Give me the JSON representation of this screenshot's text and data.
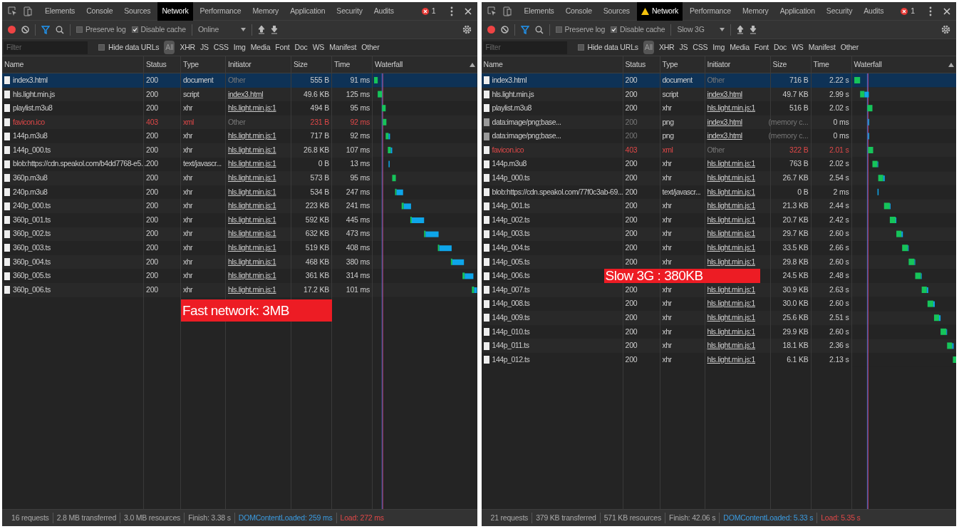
{
  "panels": [
    {
      "tabs": [
        {
          "label": "Elements",
          "selected": false,
          "warning": false
        },
        {
          "label": "Console",
          "selected": false,
          "warning": false
        },
        {
          "label": "Sources",
          "selected": false,
          "warning": false
        },
        {
          "label": "Network",
          "selected": true,
          "warning": false
        },
        {
          "label": "Performance",
          "selected": false,
          "warning": false
        },
        {
          "label": "Memory",
          "selected": false,
          "warning": false
        },
        {
          "label": "Application",
          "selected": false,
          "warning": false
        },
        {
          "label": "Security",
          "selected": false,
          "warning": false
        },
        {
          "label": "Audits",
          "selected": false,
          "warning": false
        }
      ],
      "error_count": "1",
      "preserve_log": {
        "label": "Preserve log",
        "checked": false
      },
      "disable_cache": {
        "label": "Disable cache",
        "checked": true
      },
      "throttle": "Online",
      "filter": {
        "placeholder": "Filter"
      },
      "hide_data_urls": {
        "label": "Hide data URLs",
        "checked": false
      },
      "type_filters": [
        {
          "label": "All",
          "selected": true
        },
        {
          "label": "XHR",
          "selected": false
        },
        {
          "label": "JS",
          "selected": false
        },
        {
          "label": "CSS",
          "selected": false
        },
        {
          "label": "Img",
          "selected": false
        },
        {
          "label": "Media",
          "selected": false
        },
        {
          "label": "Font",
          "selected": false
        },
        {
          "label": "Doc",
          "selected": false
        },
        {
          "label": "WS",
          "selected": false
        },
        {
          "label": "Manifest",
          "selected": false
        },
        {
          "label": "Other",
          "selected": false
        }
      ],
      "columns": [
        "Name",
        "Status",
        "Type",
        "Initiator",
        "Size",
        "Time",
        "Waterfall"
      ],
      "rows": [
        {
          "name": "index3.html",
          "status": "200",
          "type": "document",
          "initiator": "Other",
          "initiator_link": false,
          "size": "555 B",
          "time": "91 ms",
          "selected": true,
          "error": false,
          "from_cache": false
        },
        {
          "name": "hls.light.min.js",
          "status": "200",
          "type": "script",
          "initiator": "index3.html",
          "initiator_link": true,
          "size": "49.6 KB",
          "time": "125 ms",
          "selected": false,
          "error": false,
          "from_cache": false
        },
        {
          "name": "playlist.m3u8",
          "status": "200",
          "type": "xhr",
          "initiator": "hls.light.min.js:1",
          "initiator_link": true,
          "size": "494 B",
          "time": "95 ms",
          "selected": false,
          "error": false,
          "from_cache": false
        },
        {
          "name": "favicon.ico",
          "status": "403",
          "type": "xml",
          "initiator": "Other",
          "initiator_link": false,
          "size": "231 B",
          "time": "92 ms",
          "selected": false,
          "error": true,
          "from_cache": false
        },
        {
          "name": "144p.m3u8",
          "status": "200",
          "type": "xhr",
          "initiator": "hls.light.min.js:1",
          "initiator_link": true,
          "size": "717 B",
          "time": "92 ms",
          "selected": false,
          "error": false,
          "from_cache": false
        },
        {
          "name": "144p_000.ts",
          "status": "200",
          "type": "xhr",
          "initiator": "hls.light.min.js:1",
          "initiator_link": true,
          "size": "26.8 KB",
          "time": "107 ms",
          "selected": false,
          "error": false,
          "from_cache": false
        },
        {
          "name": "blob:https://cdn.speakol.com/b4dd7768-e5...",
          "status": "200",
          "type": "text/javascr...",
          "initiator": "hls.light.min.js:1",
          "initiator_link": true,
          "size": "0 B",
          "time": "13 ms",
          "selected": false,
          "error": false,
          "from_cache": false
        },
        {
          "name": "360p.m3u8",
          "status": "200",
          "type": "xhr",
          "initiator": "hls.light.min.js:1",
          "initiator_link": true,
          "size": "573 B",
          "time": "95 ms",
          "selected": false,
          "error": false,
          "from_cache": false
        },
        {
          "name": "240p.m3u8",
          "status": "200",
          "type": "xhr",
          "initiator": "hls.light.min.js:1",
          "initiator_link": true,
          "size": "534 B",
          "time": "247 ms",
          "selected": false,
          "error": false,
          "from_cache": false
        },
        {
          "name": "240p_000.ts",
          "status": "200",
          "type": "xhr",
          "initiator": "hls.light.min.js:1",
          "initiator_link": true,
          "size": "223 KB",
          "time": "241 ms",
          "selected": false,
          "error": false,
          "from_cache": false
        },
        {
          "name": "360p_001.ts",
          "status": "200",
          "type": "xhr",
          "initiator": "hls.light.min.js:1",
          "initiator_link": true,
          "size": "592 KB",
          "time": "445 ms",
          "selected": false,
          "error": false,
          "from_cache": false
        },
        {
          "name": "360p_002.ts",
          "status": "200",
          "type": "xhr",
          "initiator": "hls.light.min.js:1",
          "initiator_link": true,
          "size": "632 KB",
          "time": "473 ms",
          "selected": false,
          "error": false,
          "from_cache": false
        },
        {
          "name": "360p_003.ts",
          "status": "200",
          "type": "xhr",
          "initiator": "hls.light.min.js:1",
          "initiator_link": true,
          "size": "519 KB",
          "time": "408 ms",
          "selected": false,
          "error": false,
          "from_cache": false
        },
        {
          "name": "360p_004.ts",
          "status": "200",
          "type": "xhr",
          "initiator": "hls.light.min.js:1",
          "initiator_link": true,
          "size": "468 KB",
          "time": "380 ms",
          "selected": false,
          "error": false,
          "from_cache": false
        },
        {
          "name": "360p_005.ts",
          "status": "200",
          "type": "xhr",
          "initiator": "hls.light.min.js:1",
          "initiator_link": true,
          "size": "361 KB",
          "time": "314 ms",
          "selected": false,
          "error": false,
          "from_cache": false
        },
        {
          "name": "360p_006.ts",
          "status": "200",
          "type": "xhr",
          "initiator": "hls.light.min.js:1",
          "initiator_link": true,
          "size": "17.2 KB",
          "time": "101 ms",
          "selected": false,
          "error": false,
          "from_cache": false
        }
      ],
      "summary": [
        {
          "text": "16 requests",
          "kind": "plain"
        },
        {
          "text": "2.8 MB transferred",
          "kind": "plain"
        },
        {
          "text": "3.0 MB resources",
          "kind": "plain"
        },
        {
          "text": "Finish: 3.38 s",
          "kind": "plain"
        },
        {
          "text": "DOMContentLoaded: 259 ms",
          "kind": "dom"
        },
        {
          "text": "Load: 272 ms",
          "kind": "load"
        }
      ],
      "annotation": "Fast network: 3MB"
    },
    {
      "tabs": [
        {
          "label": "Elements",
          "selected": false,
          "warning": false
        },
        {
          "label": "Console",
          "selected": false,
          "warning": false
        },
        {
          "label": "Sources",
          "selected": false,
          "warning": false
        },
        {
          "label": "Network",
          "selected": true,
          "warning": true
        },
        {
          "label": "Performance",
          "selected": false,
          "warning": false
        },
        {
          "label": "Memory",
          "selected": false,
          "warning": false
        },
        {
          "label": "Application",
          "selected": false,
          "warning": false
        },
        {
          "label": "Security",
          "selected": false,
          "warning": false
        },
        {
          "label": "Audits",
          "selected": false,
          "warning": false
        }
      ],
      "error_count": "1",
      "preserve_log": {
        "label": "Preserve log",
        "checked": false
      },
      "disable_cache": {
        "label": "Disable cache",
        "checked": true
      },
      "throttle": "Slow 3G",
      "filter": {
        "placeholder": "Filter"
      },
      "hide_data_urls": {
        "label": "Hide data URLs",
        "checked": false
      },
      "type_filters": [
        {
          "label": "All",
          "selected": true
        },
        {
          "label": "XHR",
          "selected": false
        },
        {
          "label": "JS",
          "selected": false
        },
        {
          "label": "CSS",
          "selected": false
        },
        {
          "label": "Img",
          "selected": false
        },
        {
          "label": "Media",
          "selected": false
        },
        {
          "label": "Font",
          "selected": false
        },
        {
          "label": "Doc",
          "selected": false
        },
        {
          "label": "WS",
          "selected": false
        },
        {
          "label": "Manifest",
          "selected": false
        },
        {
          "label": "Other",
          "selected": false
        }
      ],
      "columns": [
        "Name",
        "Status",
        "Type",
        "Initiator",
        "Size",
        "Time",
        "Waterfall"
      ],
      "rows": [
        {
          "name": "index3.html",
          "status": "200",
          "type": "document",
          "initiator": "Other",
          "initiator_link": false,
          "size": "716 B",
          "time": "2.22 s",
          "selected": true,
          "error": false,
          "from_cache": false
        },
        {
          "name": "hls.light.min.js",
          "status": "200",
          "type": "script",
          "initiator": "index3.html",
          "initiator_link": true,
          "size": "49.7 KB",
          "time": "2.99 s",
          "selected": false,
          "error": false,
          "from_cache": false
        },
        {
          "name": "playlist.m3u8",
          "status": "200",
          "type": "xhr",
          "initiator": "hls.light.min.js:1",
          "initiator_link": true,
          "size": "516 B",
          "time": "2.02 s",
          "selected": false,
          "error": false,
          "from_cache": false
        },
        {
          "name": "data:image/png;base...",
          "status": "200",
          "type": "png",
          "initiator": "index3.html",
          "initiator_link": true,
          "size": "(memory c...",
          "time": "0 ms",
          "selected": false,
          "error": false,
          "from_cache": true
        },
        {
          "name": "data:image/png;base...",
          "status": "200",
          "type": "png",
          "initiator": "index3.html",
          "initiator_link": true,
          "size": "(memory c...",
          "time": "0 ms",
          "selected": false,
          "error": false,
          "from_cache": true
        },
        {
          "name": "favicon.ico",
          "status": "403",
          "type": "xml",
          "initiator": "Other",
          "initiator_link": false,
          "size": "322 B",
          "time": "2.01 s",
          "selected": false,
          "error": true,
          "from_cache": false
        },
        {
          "name": "144p.m3u8",
          "status": "200",
          "type": "xhr",
          "initiator": "hls.light.min.js:1",
          "initiator_link": true,
          "size": "763 B",
          "time": "2.02 s",
          "selected": false,
          "error": false,
          "from_cache": false
        },
        {
          "name": "144p_000.ts",
          "status": "200",
          "type": "xhr",
          "initiator": "hls.light.min.js:1",
          "initiator_link": true,
          "size": "26.7 KB",
          "time": "2.54 s",
          "selected": false,
          "error": false,
          "from_cache": false
        },
        {
          "name": "blob:https://cdn.speakol.com/77f0c3ab-69...",
          "status": "200",
          "type": "text/javascr...",
          "initiator": "hls.light.min.js:1",
          "initiator_link": true,
          "size": "0 B",
          "time": "2 ms",
          "selected": false,
          "error": false,
          "from_cache": false
        },
        {
          "name": "144p_001.ts",
          "status": "200",
          "type": "xhr",
          "initiator": "hls.light.min.js:1",
          "initiator_link": true,
          "size": "21.3 KB",
          "time": "2.44 s",
          "selected": false,
          "error": false,
          "from_cache": false
        },
        {
          "name": "144p_002.ts",
          "status": "200",
          "type": "xhr",
          "initiator": "hls.light.min.js:1",
          "initiator_link": true,
          "size": "20.7 KB",
          "time": "2.42 s",
          "selected": false,
          "error": false,
          "from_cache": false
        },
        {
          "name": "144p_003.ts",
          "status": "200",
          "type": "xhr",
          "initiator": "hls.light.min.js:1",
          "initiator_link": true,
          "size": "29.7 KB",
          "time": "2.60 s",
          "selected": false,
          "error": false,
          "from_cache": false
        },
        {
          "name": "144p_004.ts",
          "status": "200",
          "type": "xhr",
          "initiator": "hls.light.min.js:1",
          "initiator_link": true,
          "size": "33.5 KB",
          "time": "2.66 s",
          "selected": false,
          "error": false,
          "from_cache": false
        },
        {
          "name": "144p_005.ts",
          "status": "200",
          "type": "xhr",
          "initiator": "hls.light.min.js:1",
          "initiator_link": true,
          "size": "29.8 KB",
          "time": "2.60 s",
          "selected": false,
          "error": false,
          "from_cache": false
        },
        {
          "name": "144p_006.ts",
          "size": "24.5 KB",
          "time": "2.48 s",
          "selected": false,
          "error": false,
          "from_cache": false
        },
        {
          "name": "144p_007.ts",
          "status": "200",
          "type": "xhr",
          "initiator": "hls.light.min.js:1",
          "initiator_link": true,
          "size": "30.9 KB",
          "time": "2.63 s",
          "selected": false,
          "error": false,
          "from_cache": false
        },
        {
          "name": "144p_008.ts",
          "status": "200",
          "type": "xhr",
          "initiator": "hls.light.min.js:1",
          "initiator_link": true,
          "size": "30.0 KB",
          "time": "2.60 s",
          "selected": false,
          "error": false,
          "from_cache": false
        },
        {
          "name": "144p_009.ts",
          "status": "200",
          "type": "xhr",
          "initiator": "hls.light.min.js:1",
          "initiator_link": true,
          "size": "25.6 KB",
          "time": "2.51 s",
          "selected": false,
          "error": false,
          "from_cache": false
        },
        {
          "name": "144p_010.ts",
          "status": "200",
          "type": "xhr",
          "initiator": "hls.light.min.js:1",
          "initiator_link": true,
          "size": "29.9 KB",
          "time": "2.60 s",
          "selected": false,
          "error": false,
          "from_cache": false
        },
        {
          "name": "144p_011.ts",
          "status": "200",
          "type": "xhr",
          "initiator": "hls.light.min.js:1",
          "initiator_link": true,
          "size": "18.1 KB",
          "time": "2.36 s",
          "selected": false,
          "error": false,
          "from_cache": false
        },
        {
          "name": "144p_012.ts",
          "status": "200",
          "type": "xhr",
          "initiator": "hls.light.min.js:1",
          "initiator_link": true,
          "size": "6.1 KB",
          "time": "2.13 s",
          "selected": false,
          "error": false,
          "from_cache": false
        }
      ],
      "summary": [
        {
          "text": "21 requests",
          "kind": "plain"
        },
        {
          "text": "379 KB transferred",
          "kind": "plain"
        },
        {
          "text": "571 KB resources",
          "kind": "plain"
        },
        {
          "text": "Finish: 42.06 s",
          "kind": "plain"
        },
        {
          "text": "DOMContentLoaded: 5.33 s",
          "kind": "dom"
        },
        {
          "text": "Load: 5.35 s",
          "kind": "load"
        }
      ],
      "annotation": "Slow 3G : 380KB"
    }
  ]
}
